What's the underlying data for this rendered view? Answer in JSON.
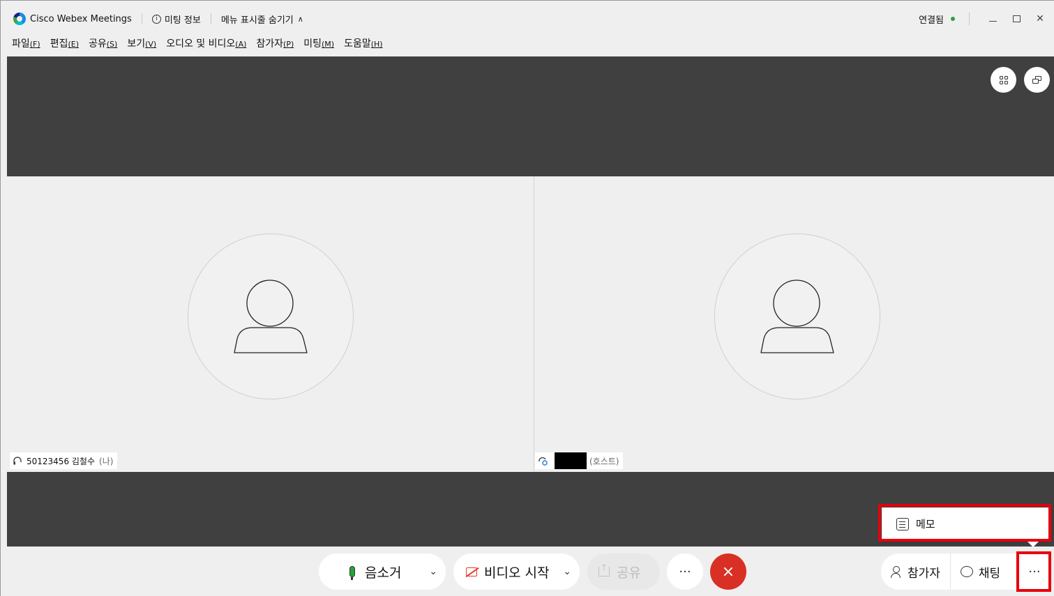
{
  "titlebar": {
    "app_title": "Cisco Webex Meetings",
    "meeting_info": "미팅 정보",
    "hide_menu": "메뉴 표시줄 숨기기",
    "connection_status": "연결됨",
    "status_color": "#2e9e3e"
  },
  "menubar": {
    "items": [
      {
        "label": "파일",
        "accel": "(F)"
      },
      {
        "label": "편집",
        "accel": "(E)"
      },
      {
        "label": "공유",
        "accel": "(S)"
      },
      {
        "label": "보기",
        "accel": "(V)"
      },
      {
        "label": "오디오 및 비디오",
        "accel": "(A)"
      },
      {
        "label": "참가자",
        "accel": "(P)"
      },
      {
        "label": "미팅",
        "accel": "(M)"
      },
      {
        "label": "도움말",
        "accel": "(H)"
      }
    ]
  },
  "participants": [
    {
      "name": "50123456 김철수",
      "suffix": "(나)"
    },
    {
      "name": "",
      "suffix": "(호스트)"
    }
  ],
  "popup": {
    "memo_label": "메모"
  },
  "controls": {
    "mute_label": "음소거",
    "video_label": "비디오 시작",
    "share_label": "공유",
    "more_label": "···",
    "leave_label": "×",
    "participants_label": "참가자",
    "chat_label": "채팅",
    "side_more_label": "···"
  },
  "colors": {
    "stage_bg": "#404040",
    "leave_button": "#d93025",
    "highlight": "#e8000d",
    "mic_active": "#26a33a",
    "video_off": "#e23b2e"
  }
}
